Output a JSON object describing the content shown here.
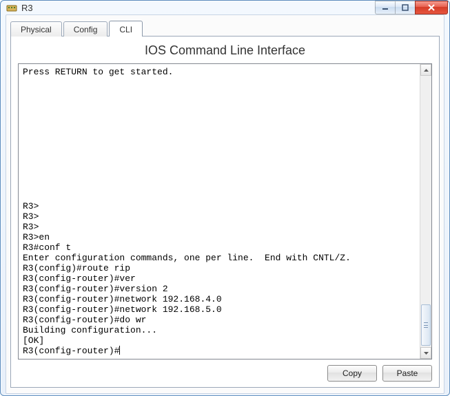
{
  "window": {
    "title": "R3"
  },
  "tabs": [
    {
      "label": "Physical"
    },
    {
      "label": "Config"
    },
    {
      "label": "CLI"
    }
  ],
  "active_tab": 2,
  "cli": {
    "heading": "IOS Command Line Interface",
    "lines": [
      "Press RETURN to get started.",
      "",
      "",
      "",
      "",
      "",
      "",
      "",
      "",
      "",
      "",
      "",
      "",
      "R3>",
      "R3>",
      "R3>",
      "R3>en",
      "R3#conf t",
      "Enter configuration commands, one per line.  End with CNTL/Z.",
      "R3(config)#route rip",
      "R3(config-router)#ver",
      "R3(config-router)#version 2",
      "R3(config-router)#network 192.168.4.0",
      "R3(config-router)#network 192.168.5.0",
      "R3(config-router)#do wr",
      "Building configuration...",
      "[OK]",
      "R3(config-router)#"
    ],
    "buttons": {
      "copy": "Copy",
      "paste": "Paste"
    }
  }
}
